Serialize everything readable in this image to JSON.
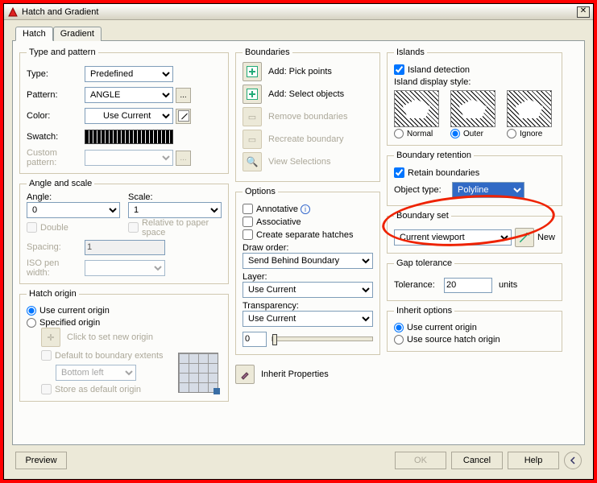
{
  "window": {
    "title": "Hatch and Gradient"
  },
  "tabs": {
    "hatch": "Hatch",
    "gradient": "Gradient"
  },
  "typePattern": {
    "legend": "Type and pattern",
    "typeLabel": "Type:",
    "typeValue": "Predefined",
    "patternLabel": "Pattern:",
    "patternValue": "ANGLE",
    "patternEllipsis": "...",
    "colorLabel": "Color:",
    "colorValue": "Use Current",
    "swatchLabel": "Swatch:",
    "customLabel": "Custom pattern:"
  },
  "angleScale": {
    "legend": "Angle and scale",
    "angleLabel": "Angle:",
    "angleValue": "0",
    "scaleLabel": "Scale:",
    "scaleValue": "1",
    "double": "Double",
    "relative": "Relative to paper space",
    "spacingLabel": "Spacing:",
    "spacingValue": "1",
    "isoLabel": "ISO pen width:"
  },
  "hatchOrigin": {
    "legend": "Hatch origin",
    "useCurrent": "Use current origin",
    "specified": "Specified origin",
    "clickSet": "Click to set new origin",
    "defaultExt": "Default to boundary extents",
    "blValue": "Bottom left",
    "storeDefault": "Store as default origin"
  },
  "boundaries": {
    "legend": "Boundaries",
    "pick": "Add: Pick points",
    "select": "Add: Select objects",
    "remove": "Remove boundaries",
    "recreate": "Recreate boundary",
    "view": "View Selections"
  },
  "options": {
    "legend": "Options",
    "annotative": "Annotative",
    "associative": "Associative",
    "separate": "Create separate hatches",
    "drawOrderLabel": "Draw order:",
    "drawOrderValue": "Send Behind Boundary",
    "layerLabel": "Layer:",
    "layerValue": "Use Current",
    "transLabel": "Transparency:",
    "transValue": "Use Current",
    "transNum": "0"
  },
  "inheritProps": "Inherit Properties",
  "islands": {
    "legend": "Islands",
    "detection": "Island detection",
    "styleLabel": "Island display style:",
    "normal": "Normal",
    "outer": "Outer",
    "ignore": "Ignore"
  },
  "boundaryRetention": {
    "legend": "Boundary retention",
    "retain": "Retain boundaries",
    "objTypeLabel": "Object type:",
    "objTypeValue": "Polyline"
  },
  "boundarySet": {
    "legend": "Boundary set",
    "value": "Current viewport",
    "newLabel": "New"
  },
  "gapTol": {
    "legend": "Gap tolerance",
    "label": "Tolerance:",
    "value": "20",
    "units": "units"
  },
  "inheritOpt": {
    "legend": "Inherit options",
    "useCurrent": "Use current origin",
    "useSource": "Use source hatch origin"
  },
  "buttons": {
    "preview": "Preview",
    "ok": "OK",
    "cancel": "Cancel",
    "help": "Help"
  }
}
